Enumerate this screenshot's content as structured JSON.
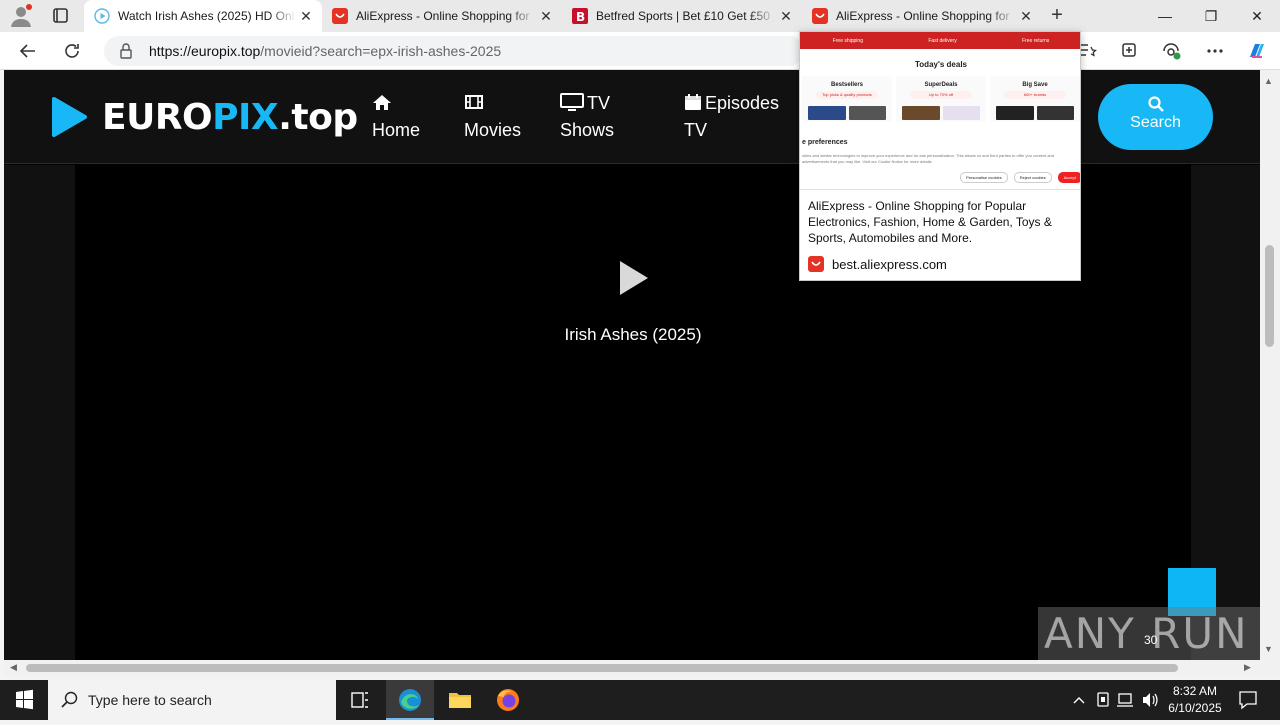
{
  "browser": {
    "tabs": [
      {
        "title": "Watch Irish Ashes (2025) HD Online",
        "active": true,
        "icon": "play-circle-icon"
      },
      {
        "title": "AliExpress - Online Shopping for",
        "active": false,
        "icon": "aliexpress-icon"
      },
      {
        "title": "Betfred Sports | Bet £10 Get £50",
        "active": false,
        "icon": "betfred-icon"
      },
      {
        "title": "AliExpress - Online Shopping for",
        "active": false,
        "icon": "aliexpress-icon"
      }
    ],
    "url_host": "https://europix.top",
    "url_path": "/movieid?search=epx-irish-ashes-2025"
  },
  "site": {
    "logo_part1": "EURO",
    "logo_part2": "PIX",
    "logo_part3": ".top",
    "nav": [
      {
        "line1": "Home",
        "line2": "",
        "icon": "home-icon"
      },
      {
        "line1": "Movies",
        "line2": "",
        "icon": "film-icon"
      },
      {
        "line1": "TV",
        "line2": "Shows",
        "icon": "tv-icon"
      },
      {
        "line1": "Episodes",
        "line2": "TV",
        "icon": "calendar-icon"
      }
    ],
    "search_label": "Search",
    "accent_color": "#18b7f5"
  },
  "player": {
    "title": "Irish Ashes (2025)"
  },
  "hovercard": {
    "preview": {
      "chips": [
        "Free shipping",
        "Fast delivery",
        "Free returns"
      ],
      "deals_heading": "Today's deals",
      "columns": [
        {
          "title": "Bestsellers",
          "pill": "Top picks & quality products"
        },
        {
          "title": "SuperDeals",
          "pill": "Up to 70% off"
        },
        {
          "title": "Big Save",
          "pill": "600+ brands"
        }
      ],
      "pref_heading": "e preferences",
      "fine_print": "okies and similar technologies to improve your experience and for ads personalisation. This allows us and third parties to offer you content and advertisements that you may like. Visit our Cookie Notice for more details.",
      "buttons": [
        "Personalise cookies",
        "Reject cookies",
        "Accept"
      ]
    },
    "description": "AliExpress - Online Shopping for Popular Electronics, Fashion, Home & Garden, Toys & Sports, Automobiles and More.",
    "domain": "best.aliexpress.com"
  },
  "watermark": {
    "text": "ANY RUN",
    "count": "30"
  },
  "taskbar": {
    "search_placeholder": "Type here to search",
    "time": "8:32 AM",
    "date": "6/10/2025"
  }
}
